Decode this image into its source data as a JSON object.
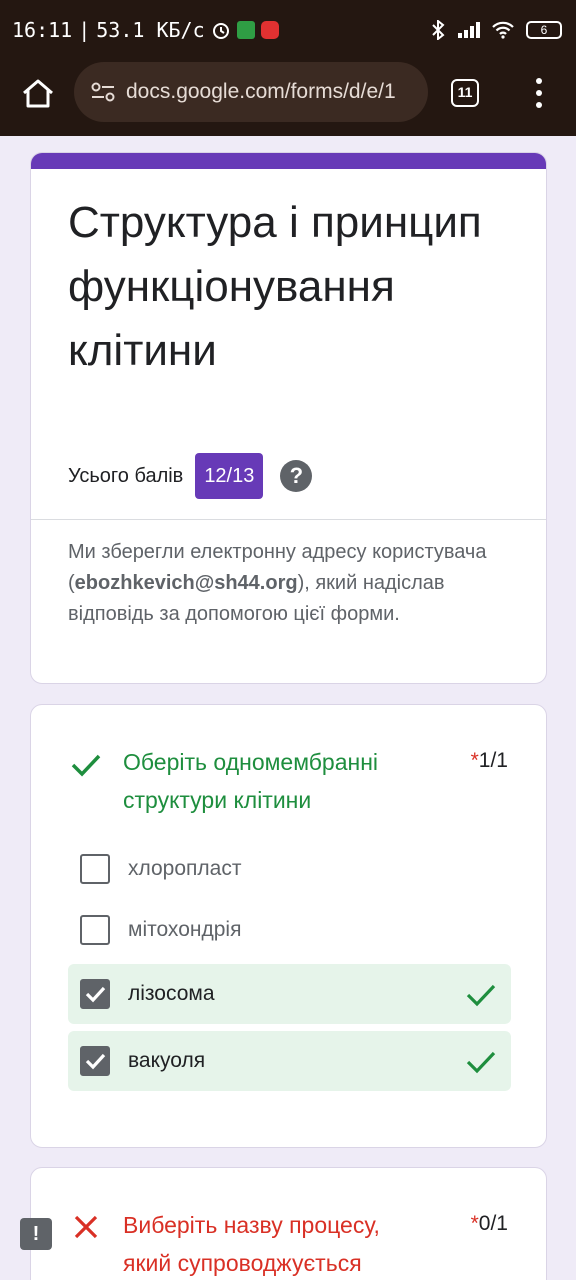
{
  "status_bar": {
    "time": "16:11",
    "separator": "|",
    "speed": "53.1 КБ/с",
    "battery": "6"
  },
  "browser": {
    "url": "docs.google.com/forms/d/e/1",
    "tab_count": "11"
  },
  "form": {
    "title": "Структура і принцип функціонування клітини",
    "score_label": "Усього балів",
    "score_value": "12/13",
    "help_symbol": "?",
    "description_before": "Ми зберегли електронну адресу користувача (",
    "email": "ebozhkevich@sh44.org",
    "description_after": "), який надіслав відповідь за допомогою цієї форми."
  },
  "questions": [
    {
      "text": "Оберіть одномембранні структури клітини",
      "required_star": "*",
      "score": "1/1",
      "options": [
        {
          "label": "хлоропласт",
          "checked": false
        },
        {
          "label": "мітохондрія",
          "checked": false
        },
        {
          "label": "лізосома",
          "checked": true
        },
        {
          "label": "вакуоля",
          "checked": true
        }
      ]
    },
    {
      "text": "Виберіть назву процесу, який супроводжується",
      "required_star": "*",
      "score": "0/1"
    }
  ],
  "colors": {
    "accent": "#673ab7",
    "correct": "#1e8e3e",
    "wrong": "#d93025",
    "page_bg": "#efebf7"
  },
  "feedback_symbol": "!"
}
